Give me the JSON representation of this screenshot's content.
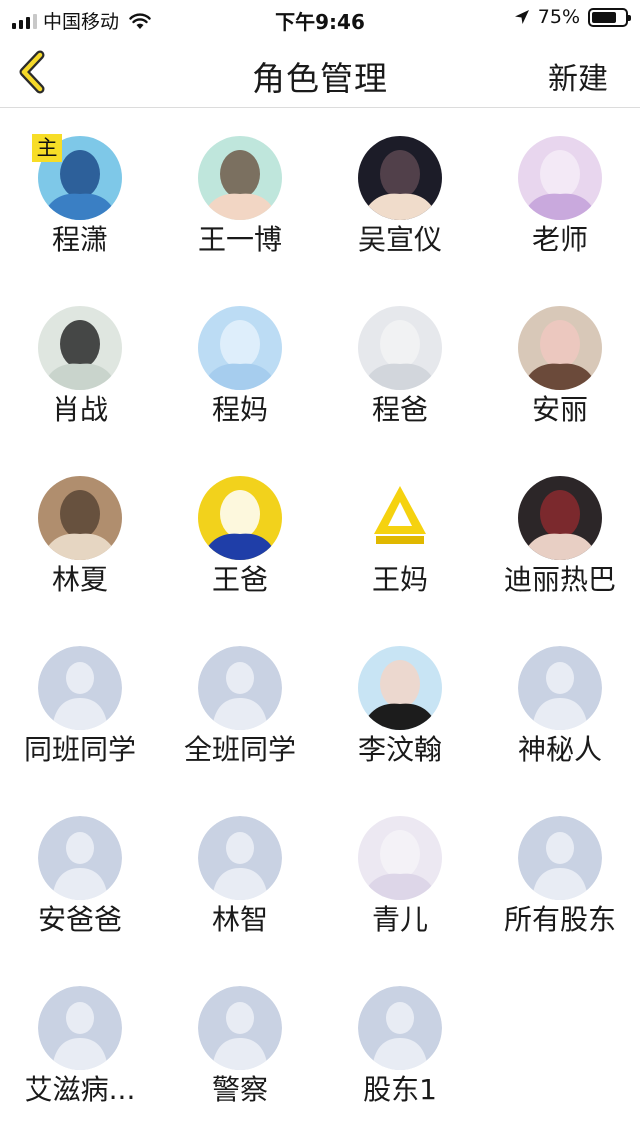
{
  "status_bar": {
    "carrier": "中国移动",
    "time": "下午9:46",
    "battery": "75%",
    "battery_level": 0.75,
    "icons": [
      "signal-icon",
      "wifi-icon",
      "location-arrow-icon",
      "battery-icon"
    ]
  },
  "nav": {
    "title": "角色管理",
    "new_label": "新建",
    "back_icon": "chevron-left-icon",
    "accent": "#f5d92a"
  },
  "main_badge": "主",
  "roles": [
    {
      "name": "程潇",
      "avatar": "photo",
      "main": true
    },
    {
      "name": "王一博",
      "avatar": "photo"
    },
    {
      "name": "吴宣仪",
      "avatar": "photo"
    },
    {
      "name": "老师",
      "avatar": "photo"
    },
    {
      "name": "肖战",
      "avatar": "photo"
    },
    {
      "name": "程妈",
      "avatar": "photo"
    },
    {
      "name": "程爸",
      "avatar": "photo"
    },
    {
      "name": "安丽",
      "avatar": "photo"
    },
    {
      "name": "林夏",
      "avatar": "photo"
    },
    {
      "name": "王爸",
      "avatar": "photo"
    },
    {
      "name": "王妈",
      "avatar": "logo"
    },
    {
      "name": "迪丽热巴",
      "avatar": "photo"
    },
    {
      "name": "同班同学",
      "avatar": "default"
    },
    {
      "name": "全班同学",
      "avatar": "default"
    },
    {
      "name": "李汶翰",
      "avatar": "photo"
    },
    {
      "name": "神秘人",
      "avatar": "default"
    },
    {
      "name": "安爸爸",
      "avatar": "default"
    },
    {
      "name": "林智",
      "avatar": "default"
    },
    {
      "name": "青儿",
      "avatar": "photo"
    },
    {
      "name": "所有股东",
      "avatar": "default"
    },
    {
      "name": "艾滋病...",
      "avatar": "default"
    },
    {
      "name": "警察",
      "avatar": "default"
    },
    {
      "name": "股东1",
      "avatar": "default"
    }
  ]
}
